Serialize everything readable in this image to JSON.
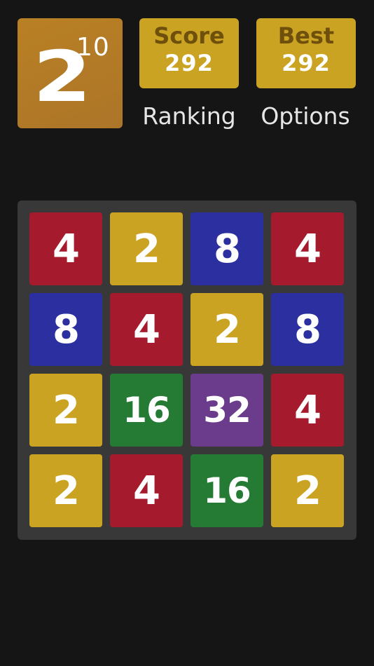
{
  "logo": {
    "base": "2",
    "exponent": "10"
  },
  "score": {
    "label": "Score",
    "value": "292"
  },
  "best": {
    "label": "Best",
    "value": "292"
  },
  "menu": {
    "ranking": "Ranking",
    "options": "Options"
  },
  "colors": {
    "background": "#151515",
    "board": "#383838",
    "logo": "#b37a26",
    "stat_box": "#c9a321",
    "stat_label": "#6e4f0c",
    "tile_2": "#c9a321",
    "tile_4": "#a51a2c",
    "tile_8": "#2b2fa0",
    "tile_16": "#257a34",
    "tile_32": "#6b3c8c"
  },
  "board": {
    "rows": [
      [
        "4",
        "2",
        "8",
        "4"
      ],
      [
        "8",
        "4",
        "2",
        "8"
      ],
      [
        "2",
        "16",
        "32",
        "4"
      ],
      [
        "2",
        "4",
        "16",
        "2"
      ]
    ]
  }
}
